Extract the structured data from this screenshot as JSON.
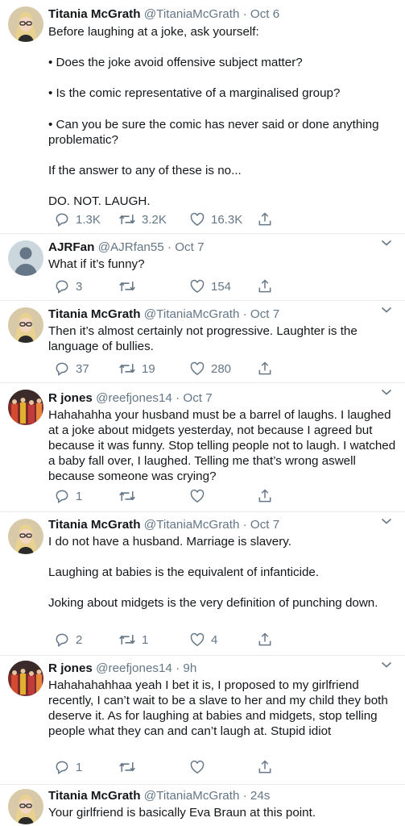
{
  "tweets": [
    {
      "name": "Titania McGrath",
      "meta": "@TitaniaMcGrath · Oct 6",
      "text": "Before laughing at a joke, ask yourself:\n\n• Does the joke avoid offensive subject matter?\n\n• Is the comic representative of a marginalised group?\n\n• Can you be sure the comic has never said or done anything problematic?\n\nIf the answer to any of these is no...\n\nDO. NOT. LAUGH.",
      "reply_count": "1.3K",
      "retweet_count": "3.2K",
      "like_count": "16.3K",
      "avatar": "titania-avatar"
    },
    {
      "name": "AJRFan",
      "meta": "@AJRfan55 · Oct 7",
      "text": "What if it’s funny?",
      "reply_count": "3",
      "retweet_count": "",
      "like_count": "154",
      "avatar": "default-avatar"
    },
    {
      "name": "Titania McGrath",
      "meta": "@TitaniaMcGrath · Oct 7",
      "text": "Then it’s almost certainly not progressive. Laughter is the language of bullies.",
      "reply_count": "37",
      "retweet_count": "19",
      "like_count": "280",
      "avatar": "titania-avatar"
    },
    {
      "name": "R jones",
      "meta": "@reefjones14 · Oct 7",
      "text": "Hahahahha your husband must be a barrel of laughs. I laughed at a joke about midgets yesterday, not because I agreed but because it was funny. Stop telling people not to laugh. I watched a baby fall over, I laughed. Telling me that’s wrong aswell because someone was crying?",
      "reply_count": "1",
      "retweet_count": "",
      "like_count": "",
      "avatar": "rjones-avatar"
    },
    {
      "name": "Titania McGrath",
      "meta": "@TitaniaMcGrath · Oct 7",
      "text": "I do not have a husband. Marriage is slavery.\n\nLaughing at babies is the equivalent of infanticide.\n\nJoking about midgets is the very definition of punching down.",
      "reply_count": "2",
      "retweet_count": "1",
      "like_count": "4",
      "avatar": "titania-avatar"
    },
    {
      "name": "R jones",
      "meta": "@reefjones14 · 9h",
      "text": "Hahahahahhaa yeah I bet it is, I proposed to my girlfriend recently, I can’t wait to be a slave to her and my child they both deserve it. As for laughing at babies and midgets, stop telling people what they can and can’t laugh at. Stupid idiot",
      "reply_count": "1",
      "retweet_count": "",
      "like_count": "",
      "avatar": "rjones-avatar"
    },
    {
      "name": "Titania McGrath",
      "meta": "@TitaniaMcGrath · 24s",
      "text": "Your girlfriend is basically Eva Braun at this point.",
      "reply_count": "",
      "retweet_count": "",
      "like_count": "",
      "avatar": "titania-avatar"
    }
  ],
  "colors": {
    "text": "#14171a",
    "muted": "#657786",
    "separator": "#e6ecf0"
  },
  "icons": [
    "reply-icon",
    "retweet-icon",
    "like-icon",
    "share-icon",
    "chevron-down-icon"
  ]
}
